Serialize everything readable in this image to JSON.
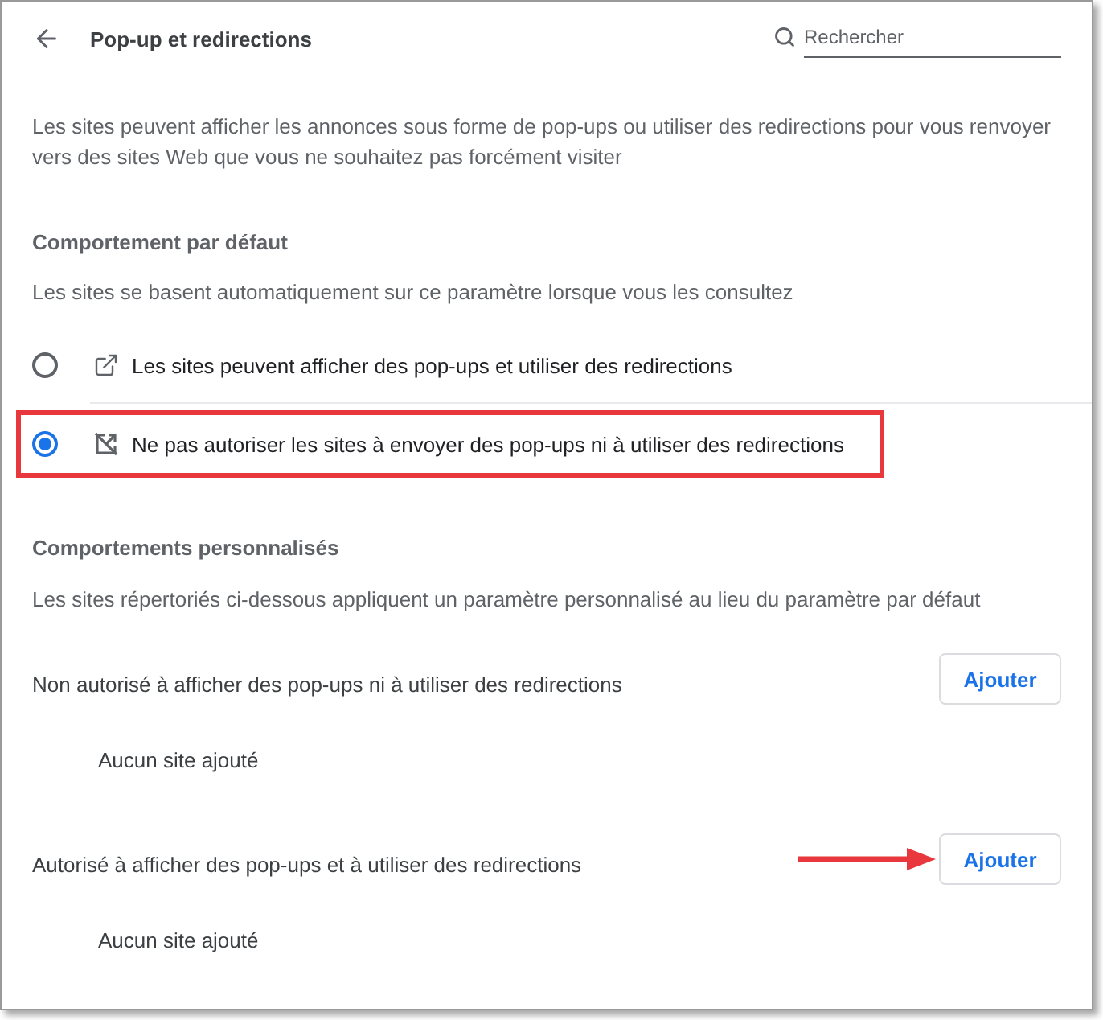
{
  "header": {
    "title": "Pop-up et redirections",
    "search": {
      "placeholder": "Rechercher"
    }
  },
  "description": "Les sites peuvent afficher les annonces sous forme de pop-ups ou utiliser des redirections pour vous renvoyer vers des sites Web que vous ne souhaitez pas forcément visiter",
  "default_behavior": {
    "heading": "Comportement par défaut",
    "subtitle": "Les sites se basent automatiquement sur ce paramètre lorsque vous les consultez",
    "options": [
      {
        "kind": "allow",
        "label": "Les sites peuvent afficher des pop-ups et utiliser des redirections",
        "selected": false,
        "highlighted": false
      },
      {
        "kind": "block",
        "label": "Ne pas autoriser les sites à envoyer des pop-ups ni à utiliser des redirections",
        "selected": true,
        "highlighted": true
      }
    ]
  },
  "custom_behaviors": {
    "heading": "Comportements personnalisés",
    "subtitle": "Les sites répertoriés ci-dessous appliquent un paramètre personnalisé au lieu du paramètre par défaut",
    "lists": [
      {
        "label": "Non autorisé à afficher des pop-ups ni à utiliser des redirections",
        "button": "Ajouter",
        "empty_text": "Aucun site ajouté",
        "arrow": false
      },
      {
        "label": "Autorisé à afficher des pop-ups et à utiliser des redirections",
        "button": "Ajouter",
        "empty_text": "Aucun site ajouté",
        "arrow": true
      }
    ]
  }
}
